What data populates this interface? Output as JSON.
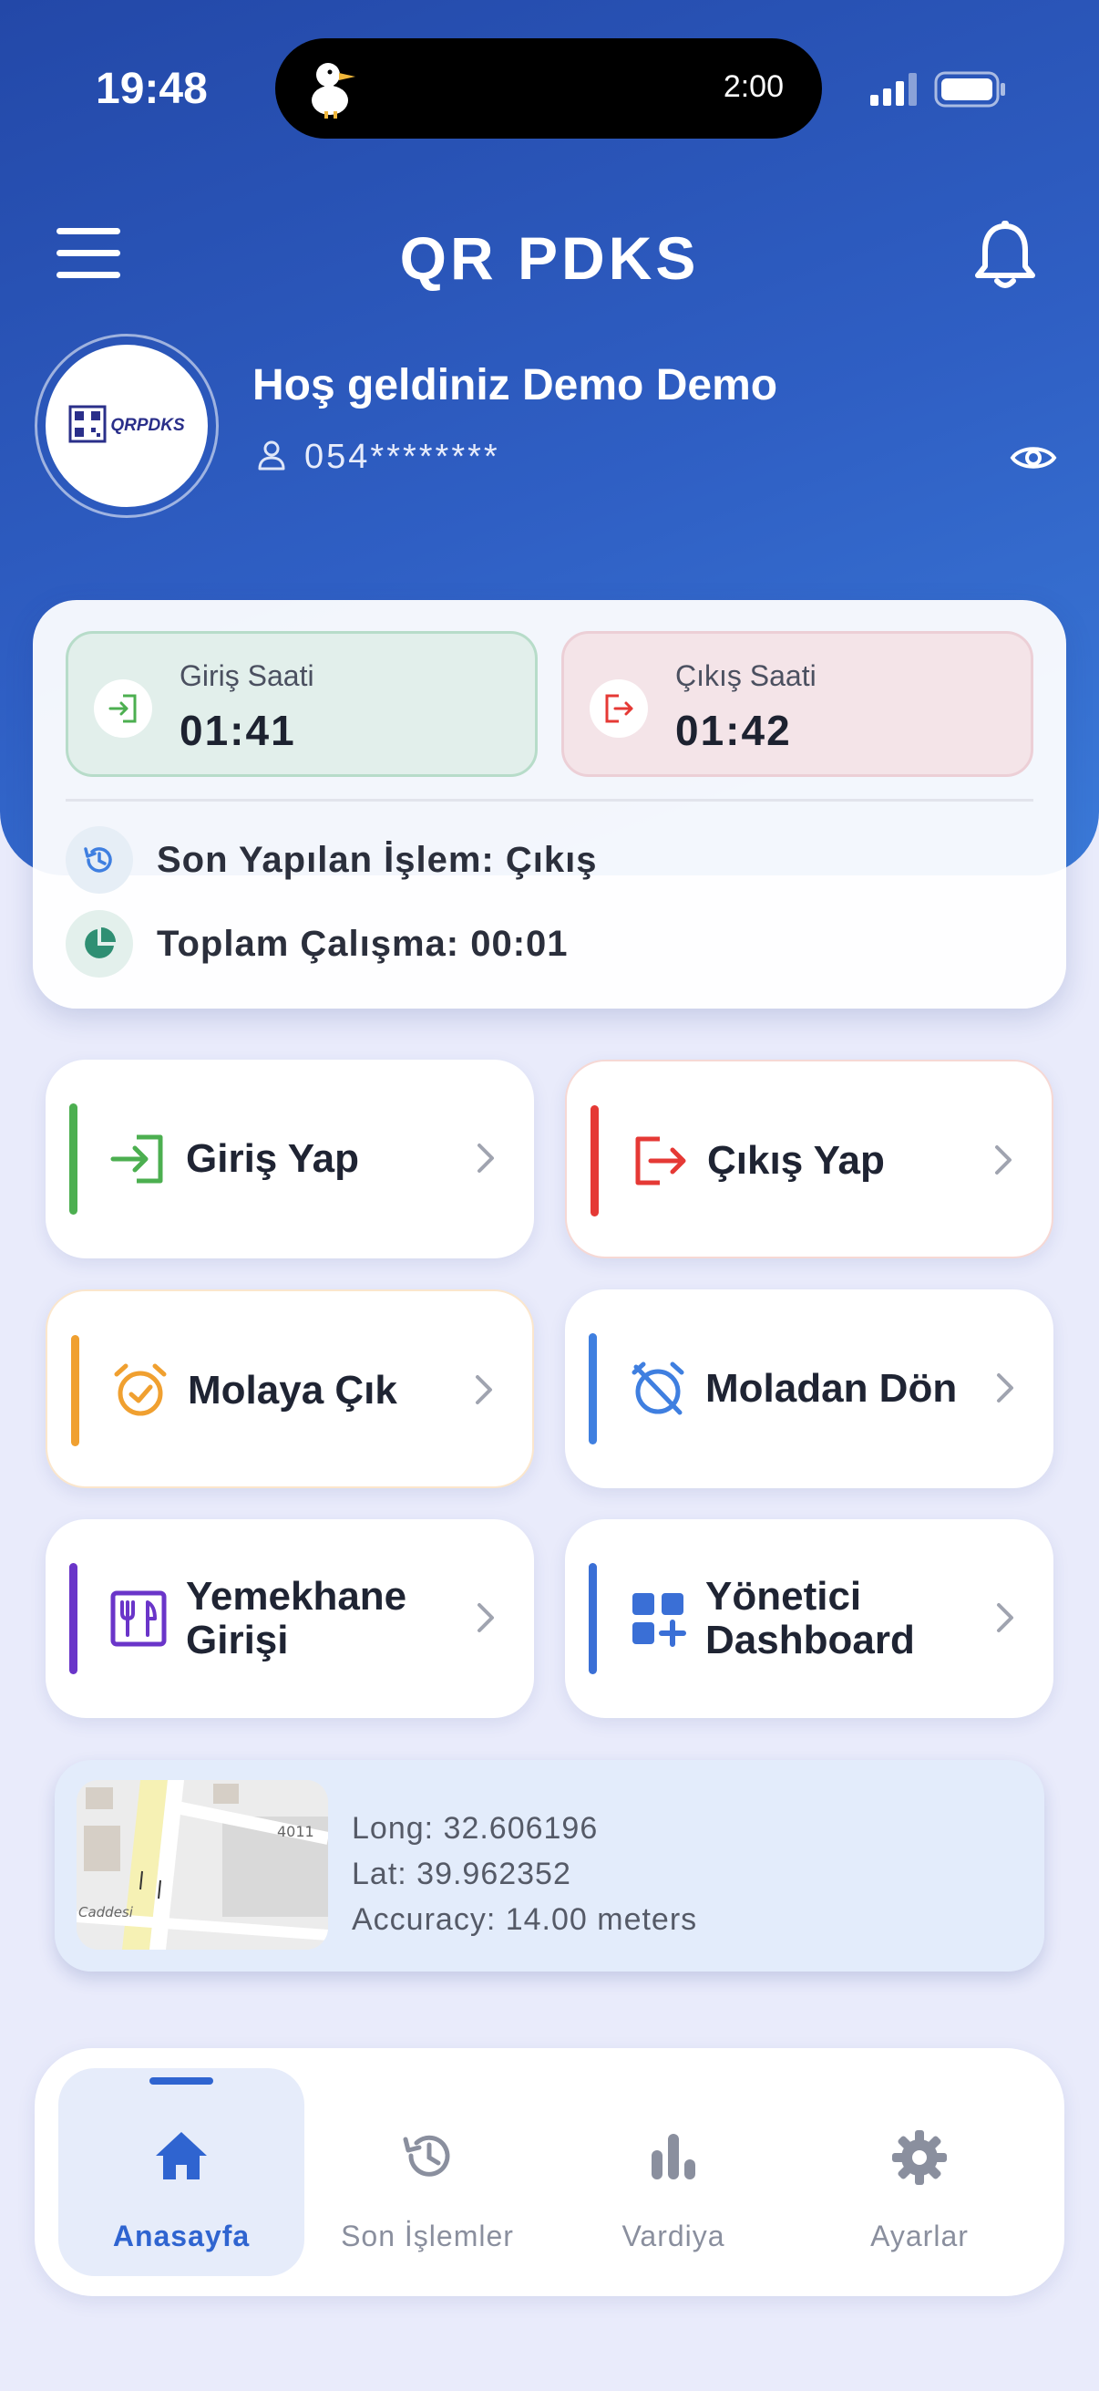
{
  "status_bar": {
    "time": "19:48",
    "island_timer": "2:00"
  },
  "header": {
    "title": "QR PDKS",
    "logo_text": "QRPDKS",
    "welcome": "Hoş geldiniz Demo Demo",
    "phone": "054********"
  },
  "summary": {
    "check_in_label": "Giriş Saati",
    "check_in_time": "01:41",
    "check_out_label": "Çıkış Saati",
    "check_out_time": "01:42",
    "last_action": "Son Yapılan İşlem: Çıkış",
    "total_work": "Toplam Çalışma: 00:01"
  },
  "actions": [
    {
      "label": "Giriş Yap",
      "color": "#4caf50"
    },
    {
      "label": "Çıkış Yap",
      "color": "#e53935"
    },
    {
      "label": "Molaya Çık",
      "color": "#f0a030"
    },
    {
      "label": "Moladan Dön",
      "color": "#3f7fe0"
    },
    {
      "label": "Yemekhane Girişi",
      "color": "#6a35c9"
    },
    {
      "label": "Yönetici Dashboard",
      "color": "#3a6fd6"
    }
  ],
  "location": {
    "long": "Long: 32.606196",
    "lat": "Lat: 39.962352",
    "accuracy": "Accuracy: 14.00 meters",
    "map_label_1": "4011",
    "map_label_2": "Caddesi"
  },
  "nav": {
    "home": "Anasayfa",
    "history": "Son İşlemler",
    "shift": "Vardiya",
    "settings": "Ayarlar",
    "active": "home"
  },
  "colors": {
    "accent": "#2f64d0",
    "header_gradient_start": "#2348a8",
    "header_gradient_end": "#3b7ad8"
  }
}
